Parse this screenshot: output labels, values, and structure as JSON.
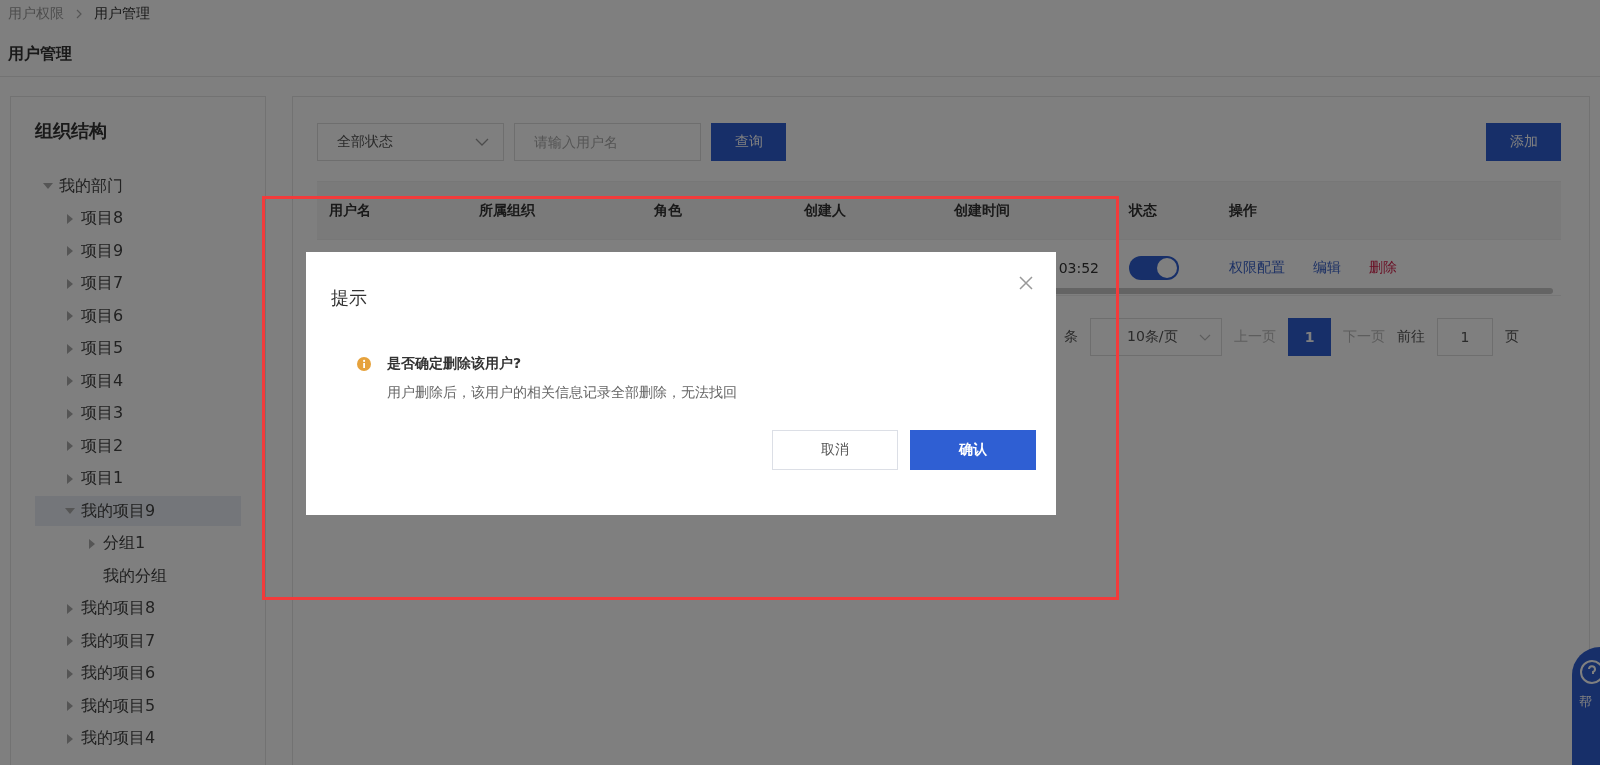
{
  "breadcrumb": [
    {
      "label": "用户权限",
      "current": false
    },
    {
      "label": "用户管理",
      "current": true
    }
  ],
  "page_title": "用户管理",
  "sidebar": {
    "title": "组织结构",
    "tree": [
      {
        "label": "我的部门",
        "kind": "branch",
        "expanded": true,
        "selected": false,
        "children": [
          {
            "label": "项目8",
            "kind": "branch",
            "expanded": false,
            "selected": false
          },
          {
            "label": "项目9",
            "kind": "branch",
            "expanded": false,
            "selected": false
          },
          {
            "label": "项目7",
            "kind": "branch",
            "expanded": false,
            "selected": false
          },
          {
            "label": "项目6",
            "kind": "branch",
            "expanded": false,
            "selected": false
          },
          {
            "label": "项目5",
            "kind": "branch",
            "expanded": false,
            "selected": false
          },
          {
            "label": "项目4",
            "kind": "branch",
            "expanded": false,
            "selected": false
          },
          {
            "label": "项目3",
            "kind": "branch",
            "expanded": false,
            "selected": false
          },
          {
            "label": "项目2",
            "kind": "branch",
            "expanded": false,
            "selected": false
          },
          {
            "label": "项目1",
            "kind": "branch",
            "expanded": false,
            "selected": false
          },
          {
            "label": "我的项目9",
            "kind": "branch",
            "expanded": true,
            "selected": true,
            "children": [
              {
                "label": "分组1",
                "kind": "branch",
                "expanded": false,
                "selected": false
              },
              {
                "label": "我的分组",
                "kind": "leaf",
                "expanded": false,
                "selected": false
              }
            ]
          },
          {
            "label": "我的项目8",
            "kind": "branch",
            "expanded": false,
            "selected": false
          },
          {
            "label": "我的项目7",
            "kind": "branch",
            "expanded": false,
            "selected": false
          },
          {
            "label": "我的项目6",
            "kind": "branch",
            "expanded": false,
            "selected": false
          },
          {
            "label": "我的项目5",
            "kind": "branch",
            "expanded": false,
            "selected": false
          },
          {
            "label": "我的项目4",
            "kind": "branch",
            "expanded": false,
            "selected": false
          }
        ]
      }
    ]
  },
  "filters": {
    "status_select": "全部状态",
    "search": {
      "placeholder": "请输入用户名"
    },
    "query_button": "查询",
    "add_button": "添加"
  },
  "table": {
    "columns": [
      "用户名",
      "所属组织",
      "角色",
      "创建人",
      "创建时间",
      "状态",
      "操作"
    ],
    "rows": [
      {
        "created_time": "03:52",
        "status_on": true,
        "actions": [
          {
            "label": "权限配置",
            "kind": "link"
          },
          {
            "label": "编辑",
            "kind": "link"
          },
          {
            "label": "删除",
            "kind": "danger"
          }
        ]
      }
    ]
  },
  "pagination": {
    "total_fragment": "条",
    "page_size": "10条/页",
    "prev": {
      "label": "上一页",
      "disabled": true
    },
    "pages": [
      {
        "label": "1",
        "selected": true
      }
    ],
    "next": {
      "label": "下一页",
      "disabled": true
    },
    "goto_label": "前往",
    "goto_value": "1",
    "goto_suffix": "页"
  },
  "dialog": {
    "title": "提示",
    "heading": "是否确定删除该用户?",
    "message": "用户删除后，该用户的相关信息记录全部删除，无法找回",
    "buttons": [
      {
        "label": "取消",
        "kind": "secondary"
      },
      {
        "label": "确认",
        "kind": "primary"
      }
    ]
  },
  "help_widget": {
    "label": "帮"
  }
}
